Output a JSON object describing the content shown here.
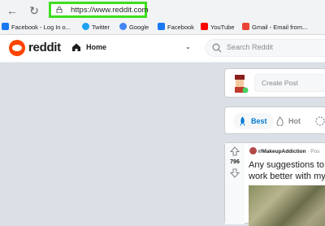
{
  "browser": {
    "url": "https://www.reddit.com",
    "bookmarks": [
      {
        "label": "Facebook - Log In o...",
        "color": "#1877f2"
      },
      {
        "label": "Twitter",
        "color": "#1da1f2"
      },
      {
        "label": "Google",
        "color": "#4285f4"
      },
      {
        "label": "Facebook",
        "color": "#1877f2"
      },
      {
        "label": "YouTube",
        "color": "#ff0000"
      },
      {
        "label": "Gmail - Email from...",
        "color": "#ea4335"
      }
    ]
  },
  "header": {
    "logo_text": "reddit",
    "home_label": "Home",
    "search_placeholder": "Search Reddit",
    "brand_color": "#ff4500"
  },
  "create_post": {
    "placeholder": "Create Post"
  },
  "sort": {
    "best_label": "Best",
    "hot_label": "Hot"
  },
  "post": {
    "subreddit": "r/MakeupAddiction",
    "posted_prefix": "· Pos",
    "votes": "796",
    "title_line1": "Any suggestions to",
    "title_line2": "work better with my"
  }
}
